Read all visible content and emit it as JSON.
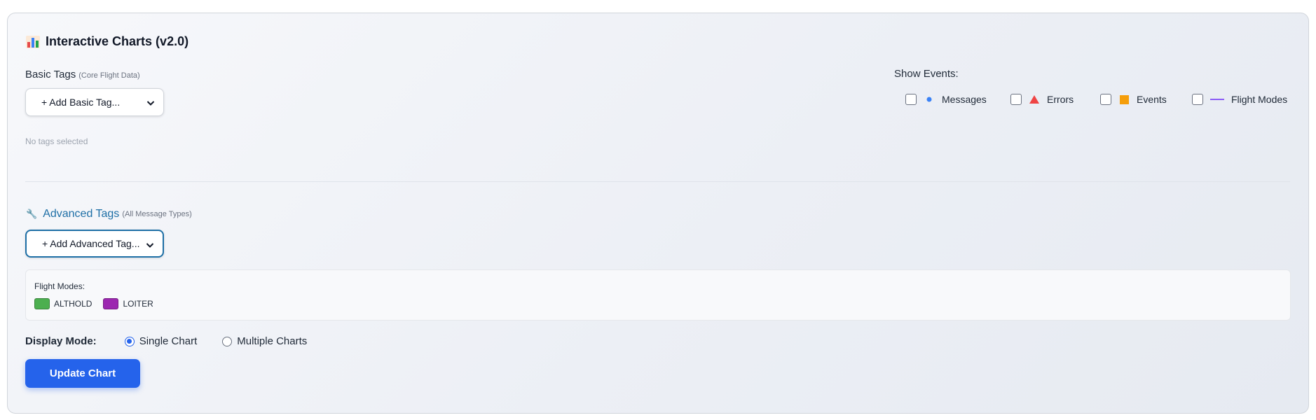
{
  "header": {
    "icon": "bar-chart-icon",
    "title": "Interactive Charts (v2.0)"
  },
  "basic_tags": {
    "label": "Basic Tags",
    "sublabel": "(Core Flight Data)",
    "select_value": "+ Add Basic Tag...",
    "empty_text": "No tags selected"
  },
  "advanced_tags": {
    "icon": "wrench-icon",
    "label": "Advanced Tags",
    "sublabel": "(All Message Types)",
    "select_value": "+ Add Advanced Tag..."
  },
  "show_events": {
    "label": "Show Events:",
    "items": [
      {
        "label": "Messages",
        "icon": "dot-icon",
        "color": "#3b82f6",
        "checked": false
      },
      {
        "label": "Errors",
        "icon": "triangle-icon",
        "color": "#ef4444",
        "checked": false
      },
      {
        "label": "Events",
        "icon": "square-icon",
        "color": "#f59e0b",
        "checked": false
      },
      {
        "label": "Flight Modes",
        "icon": "line-icon",
        "color": "#8b5cf6",
        "checked": false
      }
    ]
  },
  "flight_modes": {
    "title": "Flight Modes:",
    "items": [
      {
        "label": "ALTHOLD",
        "color": "#4caf50"
      },
      {
        "label": "LOITER",
        "color": "#9c27b0"
      }
    ]
  },
  "display_mode": {
    "label": "Display Mode:",
    "options": [
      {
        "label": "Single Chart",
        "selected": true
      },
      {
        "label": "Multiple Charts",
        "selected": false
      }
    ]
  },
  "update_button": {
    "label": "Update Chart",
    "color": "#2563eb"
  }
}
